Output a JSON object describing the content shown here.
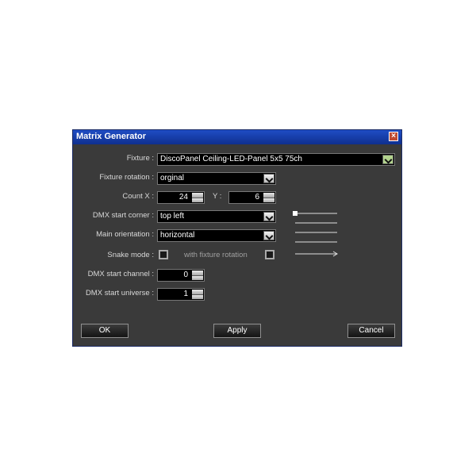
{
  "dialog": {
    "title": "Matrix Generator",
    "close_icon": "close-icon"
  },
  "form": {
    "fixture_label": "Fixture :",
    "fixture_value": "DiscoPanel Ceiling-LED-Panel 5x5 75ch",
    "fixture_rotation_label": "Fixture rotation :",
    "fixture_rotation_value": "orginal",
    "count_x_label": "Count X :",
    "count_x_value": "24",
    "y_label": "Y :",
    "y_value": "6",
    "dmx_start_corner_label": "DMX start corner :",
    "dmx_start_corner_value": "top left",
    "main_orientation_label": "Main orientation :",
    "main_orientation_value": "horizontal",
    "snake_mode_label": "Snake mode :",
    "with_fixture_rotation_label": "with fixture rotation",
    "dmx_start_channel_label": "DMX start channel :",
    "dmx_start_channel_value": "0",
    "dmx_start_universe_label": "DMX start universe :",
    "dmx_start_universe_value": "1"
  },
  "buttons": {
    "ok": "OK",
    "apply": "Apply",
    "cancel": "Cancel"
  },
  "colors": {
    "dialog_bg": "#3a3a3a",
    "titlebar": "#1f4dc4",
    "field_bg": "#000000",
    "value_text": "#ffffff"
  }
}
